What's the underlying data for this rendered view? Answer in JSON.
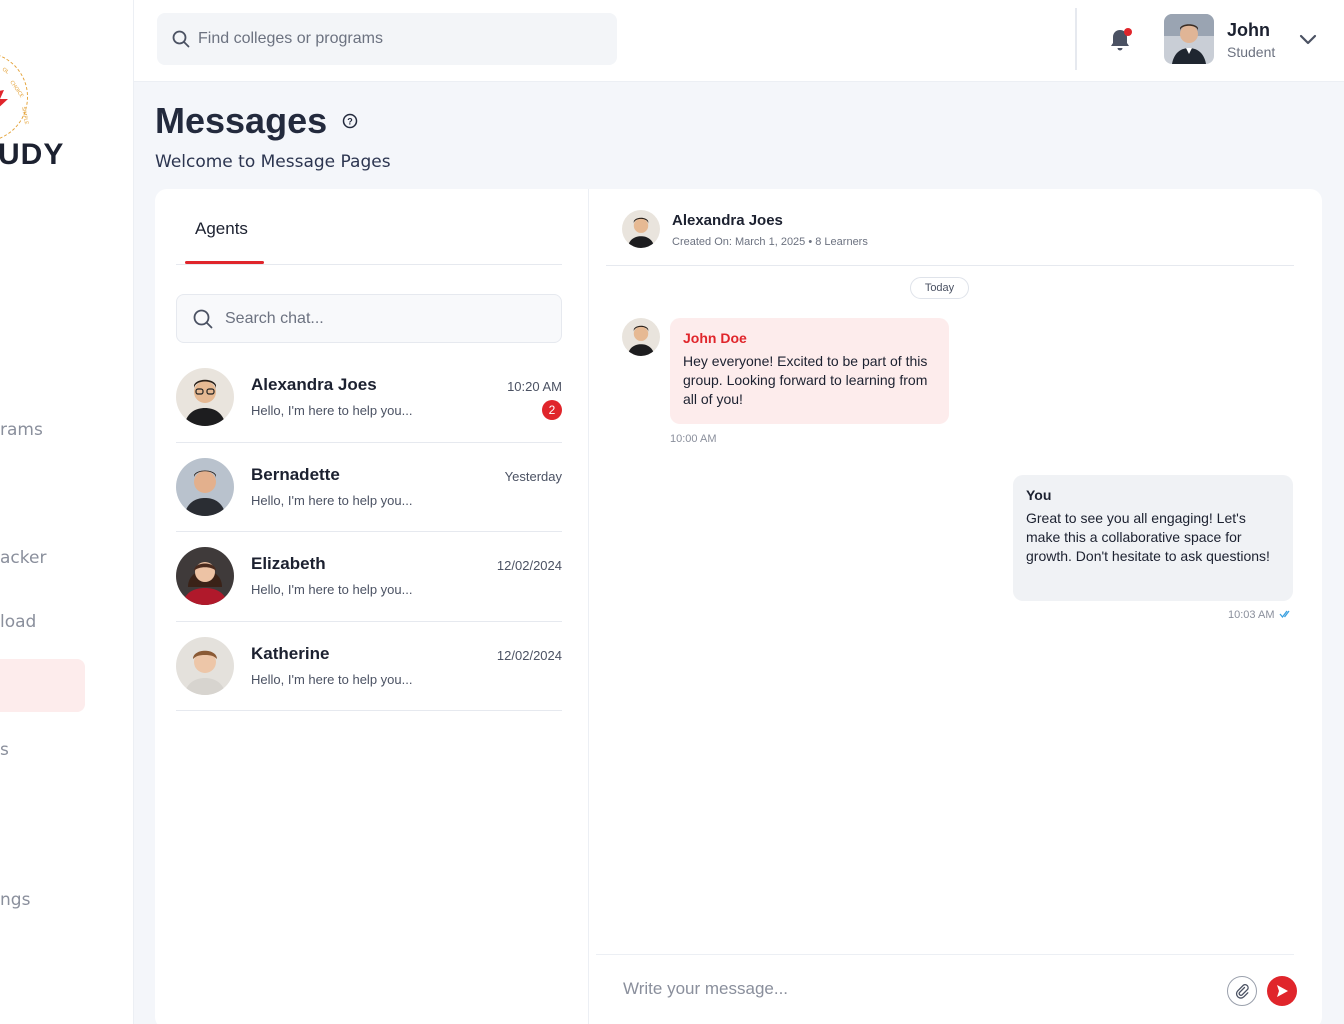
{
  "sidebar": {
    "logo_text": "UDY",
    "nav": [
      {
        "label": "rams"
      },
      {
        "label": "acker"
      },
      {
        "label": "load"
      },
      {
        "label": ""
      },
      {
        "label": "s"
      },
      {
        "label": "ngs"
      }
    ]
  },
  "header": {
    "search_placeholder": "Find colleges or programs",
    "user": {
      "name": "John",
      "role": "Student"
    }
  },
  "page": {
    "title": "Messages",
    "subtitle": "Welcome to Message Pages"
  },
  "agents": {
    "tab_label": "Agents",
    "search_placeholder": "Search chat...",
    "conversations": [
      {
        "name": "Alexandra Joes",
        "preview": "Hello, I'm here to help you...",
        "time": "10:20 AM",
        "unread": "2"
      },
      {
        "name": "Bernadette",
        "preview": "Hello, I'm here to help you...",
        "time": "Yesterday"
      },
      {
        "name": "Elizabeth",
        "preview": "Hello, I'm here to help you...",
        "time": "12/02/2024"
      },
      {
        "name": "Katherine",
        "preview": "Hello, I'm here to help you...",
        "time": "12/02/2024"
      }
    ]
  },
  "chat": {
    "title": "Alexandra Joes",
    "meta": "Created On: March 1, 2025 • 8 Learners",
    "day_label": "Today",
    "messages": [
      {
        "sender": "John Doe",
        "text": "Hey everyone! Excited to be part of this group. Looking forward to learning from all of you!",
        "time": "10:00 AM"
      },
      {
        "sender": "You",
        "text": "Great to see you all engaging! Let's make this a collaborative space for growth. Don't hesitate to ask questions!",
        "time": "10:03 AM"
      }
    ],
    "composer_placeholder": "Write your message..."
  },
  "colors": {
    "accent": "#e0252b",
    "accent_soft": "#fdecec",
    "text_dark": "#1c2130",
    "muted": "#6c7280"
  }
}
